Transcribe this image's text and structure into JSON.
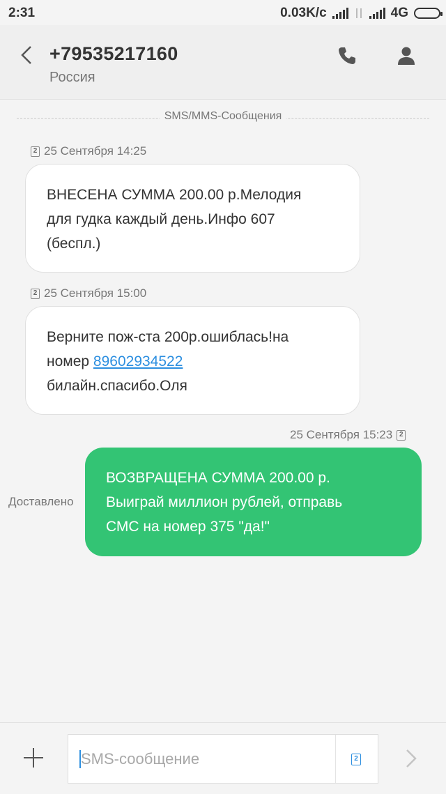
{
  "status_bar": {
    "time": "2:31",
    "net_speed": "0.03K/c",
    "network_type": "4G"
  },
  "header": {
    "title": "+79535217160",
    "subtitle": "Россия",
    "icons": [
      "back-arrow-icon",
      "phone-icon",
      "contact-icon"
    ]
  },
  "thread": {
    "divider_label": "SMS/MMS-Сообщения",
    "messages": [
      {
        "direction": "incoming",
        "sim": "2",
        "timestamp": "25 Сентября 14:25",
        "lines": [
          "ВНЕСЕНА СУММА 200.00 р.Мелодия",
          "для гудка каждый день.Инфо 607",
          "(беспл.)"
        ]
      },
      {
        "direction": "incoming",
        "sim": "2",
        "timestamp": "25 Сентября 15:00",
        "line1": "Верните пож-ста 200р.ошиблась!на",
        "line2_prefix": "номер",
        "line2_link": "89602934522",
        "line3": "билайн.спасибо.Оля"
      },
      {
        "direction": "outgoing",
        "sim": "2",
        "timestamp": "25 Сентября 15:23",
        "status": "Доставлено",
        "lines": [
          "ВОЗВРАЩЕНА СУММА 200.00 р.",
          "Выиграй миллион рублей, отправь",
          "СМС на номер 375 \"да!\""
        ]
      }
    ]
  },
  "composer": {
    "placeholder": "SMS-сообщение",
    "sim": "2"
  },
  "colors": {
    "outgoing_bubble": "#33c474",
    "link": "#2d8fe0",
    "background": "#f4f4f4"
  }
}
